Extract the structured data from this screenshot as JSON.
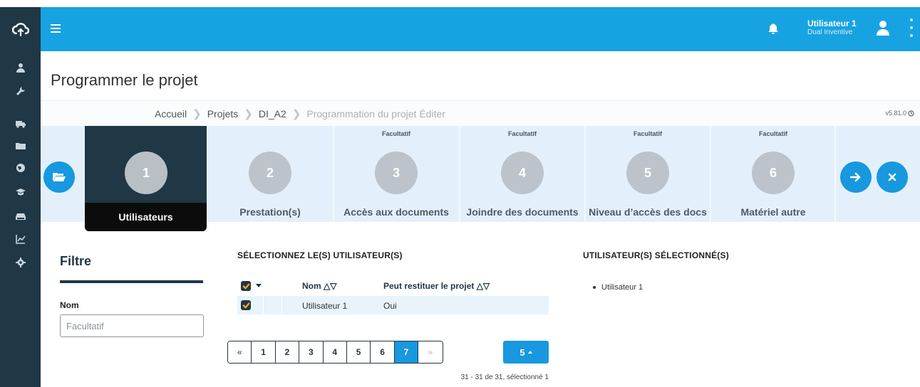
{
  "header": {
    "user_name": "Utilisateur 1",
    "user_org": "Dual Inventive",
    "color_primary": "#17a3e1",
    "color_rail": "#203745"
  },
  "page": {
    "title": "Programmer le projet",
    "version": "v5.81.0"
  },
  "breadcrumb": {
    "items": [
      "Accueil",
      "Projets",
      "DI_A2"
    ],
    "current": "Programmation du projet Éditer"
  },
  "rail": {
    "icons": [
      "cloud-logo-icon",
      "user-icon",
      "wrench-icon",
      "truck-icon",
      "folder-icon",
      "globe-icon",
      "graduation-cap-icon",
      "hdd-icon",
      "line-chart-icon",
      "gear-icon"
    ]
  },
  "wizard": {
    "steps": [
      {
        "number": "1",
        "label": "Utilisateurs",
        "optional": ""
      },
      {
        "number": "2",
        "label": "Prestation(s)",
        "optional": ""
      },
      {
        "number": "3",
        "label": "Accès aux documents",
        "optional": "Facultatif"
      },
      {
        "number": "4",
        "label": "Joindre des documents",
        "optional": "Facultatif"
      },
      {
        "number": "5",
        "label": "Niveau d’accès des docs",
        "optional": "Facultatif"
      },
      {
        "number": "6",
        "label": "Matériel autre",
        "optional": "Facultatif"
      }
    ],
    "active_step": 1
  },
  "filter": {
    "title": "Filtre",
    "name_label": "Nom",
    "name_placeholder": "Facultatif",
    "name_value": ""
  },
  "users_table": {
    "title": "SÉLECTIONNEZ LE(S) UTILISATEUR(S)",
    "columns": [
      "Nom △▽",
      "Peut restituer le projet △▽"
    ],
    "rows": [
      {
        "name": "Utilisateur 1",
        "can_restore": "Oui",
        "checked": true
      }
    ]
  },
  "pagination": {
    "prev": "«",
    "next": "»",
    "pages": [
      "1",
      "2",
      "3",
      "4",
      "5",
      "6",
      "7"
    ],
    "active_page": "7",
    "page_size": "5",
    "info": "31 - 31 de 31, sélectionné 1"
  },
  "selected": {
    "title": "UTILISATEUR(S) SÉLECTIONNÉ(S)",
    "items": [
      "Utilisateur 1"
    ]
  }
}
